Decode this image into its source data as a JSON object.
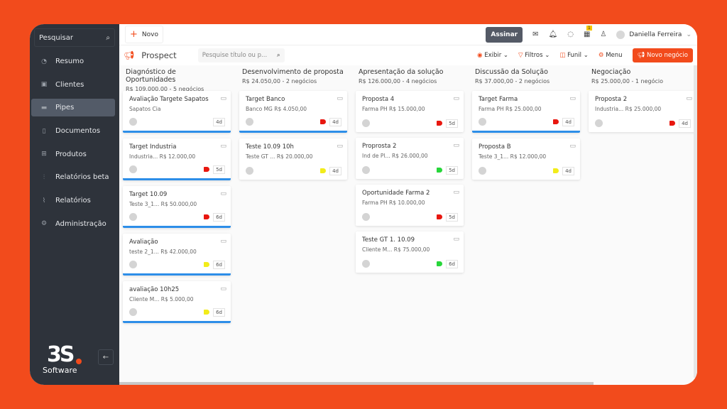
{
  "sidebar": {
    "search_label": "Pesquisar",
    "items": [
      {
        "label": "Resumo",
        "icon": "gauge-icon",
        "glyph": "◔"
      },
      {
        "label": "Clientes",
        "icon": "id-card-icon",
        "glyph": "▣"
      },
      {
        "label": "Pipes",
        "icon": "money-icon",
        "glyph": "▬",
        "active": true
      },
      {
        "label": "Documentos",
        "icon": "document-icon",
        "glyph": "▯"
      },
      {
        "label": "Produtos",
        "icon": "box-icon",
        "glyph": "⊞"
      },
      {
        "label": "Relatórios beta",
        "icon": "bar-chart-icon",
        "glyph": "⫶"
      },
      {
        "label": "Relatórios",
        "icon": "line-chart-icon",
        "glyph": "⌇"
      },
      {
        "label": "Administração",
        "icon": "gear-icon",
        "glyph": "⚙"
      }
    ],
    "logo_text": "3S",
    "logo_sub": "Software"
  },
  "topbar": {
    "novo_label": "Novo",
    "assinar_label": "Assinar",
    "calendar_badge": "1",
    "user_name": "Daniella Ferreira"
  },
  "pipeline": {
    "title": "Prospect",
    "search_placeholder": "Pesquise título ou p...",
    "exibir": "Exibir",
    "filtros": "Filtros",
    "funil": "Funil",
    "menu": "Menu",
    "novo_negocio": "Novo negócio"
  },
  "colors": {
    "accent": "#f24b1c",
    "red_tag": "#e8170f",
    "yellow_tag": "#f2ec1a",
    "green_tag": "#27d63a",
    "progress": "#2d8ee8"
  },
  "columns": [
    {
      "title": "Diagnóstico de Oportunidades",
      "summary": "R$ 109.000,00 - 5 negócios",
      "cards": [
        {
          "name": "Avaliação Targete Sapatos",
          "client": "Sapatos Cia",
          "value": "",
          "tag": "",
          "days": "4d",
          "blue": true
        },
        {
          "name": "Target Industria",
          "client": "Industria...",
          "value": "R$ 12.000,00",
          "tag": "red",
          "days": "5d",
          "blue": true
        },
        {
          "name": "Target 10.09",
          "client": "Teste 3_1...",
          "value": "R$ 50.000,00",
          "tag": "red",
          "days": "6d",
          "blue": true
        },
        {
          "name": "Avaliação",
          "client": "teste 2_1...",
          "value": "R$ 42.000,00",
          "tag": "yellow",
          "days": "6d",
          "blue": true
        },
        {
          "name": "avaliação 10h25",
          "client": "Cliente M...",
          "value": "R$ 5.000,00",
          "tag": "yellow",
          "days": "6d",
          "blue": true
        }
      ]
    },
    {
      "title": "Desenvolvimento de proposta",
      "summary": "R$ 24.050,00 - 2 negócios",
      "cards": [
        {
          "name": "Target Banco",
          "client": "Banco MG",
          "value": "R$ 4.050,00",
          "tag": "red",
          "days": "4d",
          "blue": true
        },
        {
          "name": "Teste 10.09 10h",
          "client": "Teste GT ...",
          "value": "R$ 20.000,00",
          "tag": "yellow",
          "days": "4d",
          "blue": false
        }
      ]
    },
    {
      "title": "Apresentação da solução",
      "summary": "R$ 126.000,00 - 4 negócios",
      "cards": [
        {
          "name": "Proposta 4",
          "client": "Farma PH",
          "value": "R$ 15.000,00",
          "tag": "red",
          "days": "5d",
          "blue": false
        },
        {
          "name": "Proprosta 2",
          "client": "Ind de Pl...",
          "value": "R$ 26.000,00",
          "tag": "green",
          "days": "5d",
          "blue": false
        },
        {
          "name": "Oportunidade Farma 2",
          "client": "Farma PH",
          "value": "R$ 10.000,00",
          "tag": "red",
          "days": "5d",
          "blue": false
        },
        {
          "name": "Teste GT 1. 10.09",
          "client": "Cliente M...",
          "value": "R$ 75.000,00",
          "tag": "green",
          "days": "6d",
          "blue": false
        }
      ]
    },
    {
      "title": "Discussão da Solução",
      "summary": "R$ 37.000,00 - 2 negócios",
      "cards": [
        {
          "name": "Target Farma",
          "client": "Farma PH",
          "value": "R$ 25.000,00",
          "tag": "red",
          "days": "4d",
          "blue": true
        },
        {
          "name": "Proposta B",
          "client": "Teste 3_1...",
          "value": "R$ 12.000,00",
          "tag": "yellow",
          "days": "4d",
          "blue": false
        }
      ]
    },
    {
      "title": "Negociação",
      "summary": "R$ 25.000,00 - 1 negócio",
      "cards": [
        {
          "name": "Proposta 2",
          "client": "Industria...",
          "value": "R$ 25.000,00",
          "tag": "red",
          "days": "4d",
          "blue": false
        }
      ]
    }
  ]
}
